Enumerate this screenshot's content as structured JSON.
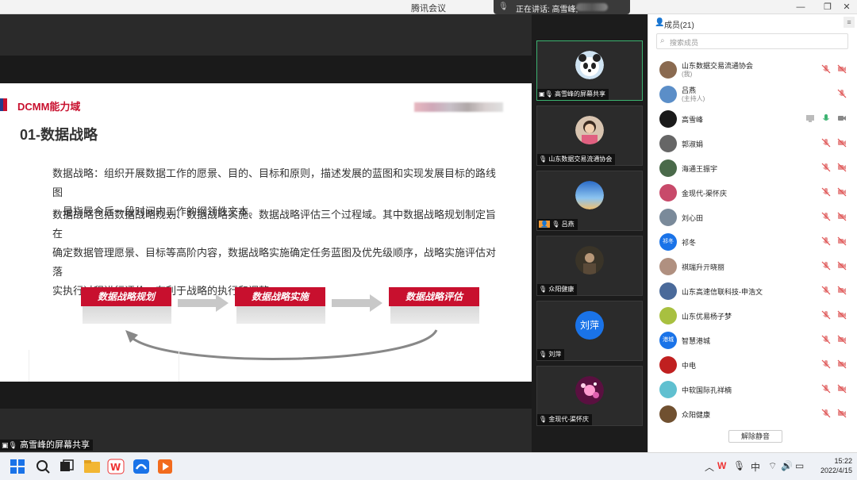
{
  "window": {
    "title": "腾讯会议",
    "speaking_label": "正在讲话: 高雪峰;"
  },
  "slide": {
    "section_tag": "DCMM能力域",
    "title": "01-数据战略",
    "para1_line1": "数据战略：组织开展数据工作的愿景、目的、目标和原则，描述发展的蓝图和实现发展目标的路线图",
    "para1_line2": "，是指导今后一段时间内工作的纲领性文本。",
    "para2_line1": "数据战略包括数据战略规划、数据战略实施、数据战略评估三个过程域。其中数据战略规划制定旨在",
    "para2_line2": "确定数据管理愿景、目标等高阶内容，数据战略实施确定任务蓝图及优先级顺序，战略实施评估对落",
    "para2_line3": "实执行过程进行评价，有利于战略的执行和调整。",
    "flow": [
      "数据战略规划",
      "数据战略实施",
      "数据战略评估"
    ]
  },
  "share_label": "高雪峰的屏幕共享",
  "video_tiles": [
    {
      "caption": "高雪峰的屏幕共享",
      "avatar": "panda-avatar",
      "active": true
    },
    {
      "caption": "山东数据交易流通协会",
      "avatar": "child-photo-avatar"
    },
    {
      "caption": "吕燕",
      "avatar": "sky-avatar"
    },
    {
      "caption": "众阳健康",
      "avatar": "dark-photo-avatar"
    },
    {
      "caption": "刘萍",
      "avatar_text": "刘萍",
      "avatar_color": "#1a73e8"
    },
    {
      "caption": "金现代-渠怀庆",
      "avatar": "pink-bokeh-avatar"
    }
  ],
  "members": {
    "title": "成员(21)",
    "search_placeholder": "搜索成员",
    "unmute_button": "解除静音",
    "list": [
      {
        "name": "山东数据交易流通协会",
        "sub": "(我)",
        "mic": "muted",
        "cam": "off"
      },
      {
        "name": "吕燕",
        "sub": "(主持人)",
        "mic": "muted",
        "cam": "none"
      },
      {
        "name": "高雪峰",
        "sub": "",
        "mic": "on",
        "cam": "on",
        "share": true
      },
      {
        "name": "郭淑娟",
        "sub": "",
        "mic": "muted",
        "cam": "off"
      },
      {
        "name": "海通王振宇",
        "sub": "",
        "mic": "muted",
        "cam": "off"
      },
      {
        "name": "金现代-渠怀庆",
        "sub": "",
        "mic": "muted",
        "cam": "off"
      },
      {
        "name": "刘心田",
        "sub": "",
        "mic": "muted",
        "cam": "off"
      },
      {
        "name": "祁冬",
        "sub": "",
        "mic": "muted",
        "cam": "off",
        "avatar_text": "祁冬",
        "avatar_color": "#1a73e8"
      },
      {
        "name": "祺瑞升亓晓丽",
        "sub": "",
        "mic": "muted",
        "cam": "off"
      },
      {
        "name": "山东高速信联科技-申浩文",
        "sub": "",
        "mic": "muted",
        "cam": "off"
      },
      {
        "name": "山东优易杨子梦",
        "sub": "",
        "mic": "muted",
        "cam": "off"
      },
      {
        "name": "智慧港城",
        "sub": "",
        "mic": "muted",
        "cam": "off",
        "avatar_text": "港城",
        "avatar_color": "#1a73e8"
      },
      {
        "name": "中电",
        "sub": "",
        "mic": "muted",
        "cam": "off"
      },
      {
        "name": "中软国际孔祥楠",
        "sub": "",
        "mic": "muted",
        "cam": "off"
      },
      {
        "name": "众阳健康",
        "sub": "",
        "mic": "muted",
        "cam": "off"
      }
    ]
  },
  "taskbar": {
    "ime": "中",
    "time": "15:22",
    "date": "2022/4/15"
  }
}
